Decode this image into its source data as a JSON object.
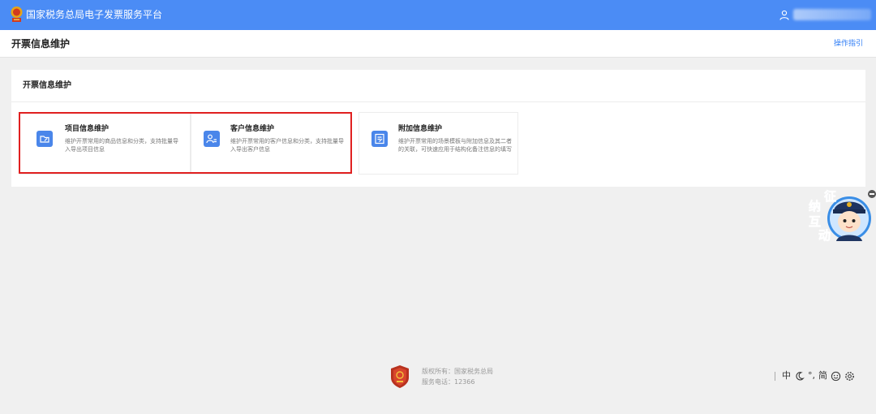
{
  "header": {
    "app_title": "国家税务总局电子发票服务平台",
    "icons": {
      "logo": "tax-emblem-icon",
      "user": "user-icon"
    }
  },
  "page": {
    "title": "开票信息维护",
    "guide_link": "操作指引"
  },
  "panel": {
    "title": "开票信息维护",
    "cards": [
      {
        "title": "项目信息维护",
        "desc": "维护开票常用的商品信息和分类，支持批量导入导出项目信息",
        "icon": "folder-edit-icon"
      },
      {
        "title": "客户信息维护",
        "desc": "维护开票常用的客户信息和分类，支持批量导入导出客户信息",
        "icon": "user-card-icon"
      },
      {
        "title": "附加信息维护",
        "desc": "维护开票常用的场景模板与附加信息及其二者的关联，可快速应用于结构化备注信息的填写",
        "icon": "document-edit-icon"
      }
    ]
  },
  "assistant": {
    "chars": [
      "纳",
      "征",
      "互",
      "动"
    ],
    "icon": "tax-officer-avatar-icon"
  },
  "footer": {
    "copyright": "版权所有：国家税务总局",
    "hotline": "服务电话：12366"
  },
  "toolbar": {
    "lang": "中",
    "punct": "°,",
    "simp": "简",
    "icons": [
      "moon-icon",
      "emoji-icon",
      "settings-icon"
    ]
  },
  "colors": {
    "brand": "#4b8cf5",
    "accent": "#4a86ea",
    "highlight": "#e02020"
  }
}
